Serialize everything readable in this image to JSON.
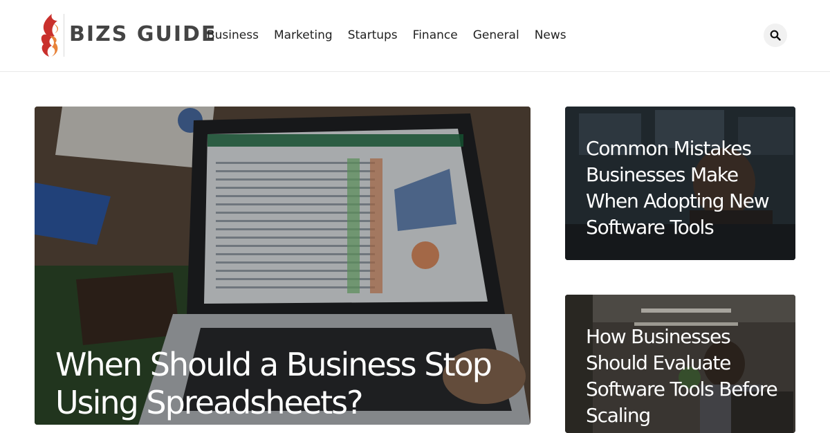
{
  "header": {
    "logo_text": "BIZS GUIDE",
    "nav": [
      "Business",
      "Marketing",
      "Startups",
      "Finance",
      "General",
      "News"
    ],
    "search_icon": "search-icon"
  },
  "featured": {
    "main": {
      "title": "When Should a Business Stop Using Spreadsheets?"
    },
    "side": [
      {
        "title": "Common Mistakes Businesses Make When Adopting New Software Tools"
      },
      {
        "title": "How Businesses Should Evaluate Software Tools Before Scaling"
      }
    ]
  },
  "colors": {
    "logo_red": "#c9302c",
    "logo_orange": "#e8833a",
    "text_dark": "#222222"
  }
}
